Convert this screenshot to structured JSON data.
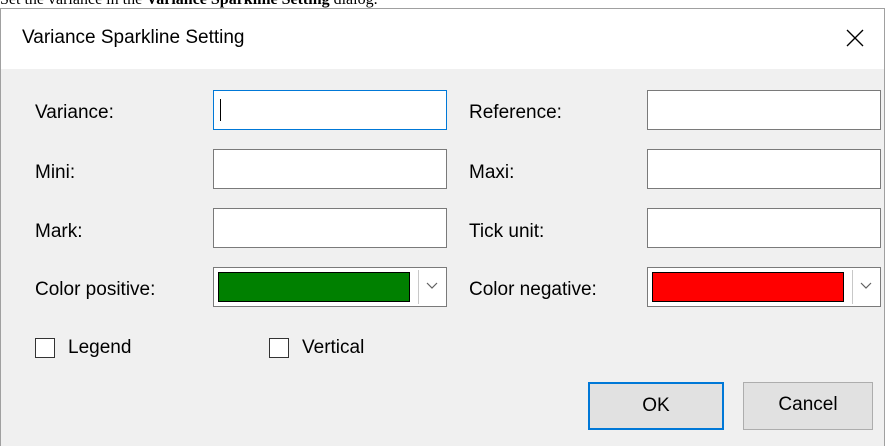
{
  "instruction": {
    "prefix": "Set the variance in the ",
    "bold": "Variance Sparkline Setting",
    "suffix": " dialog."
  },
  "dialog": {
    "title": "Variance Sparkline Setting",
    "close_icon": "close-icon"
  },
  "fields": {
    "variance": {
      "label": "Variance:",
      "value": ""
    },
    "reference": {
      "label": "Reference:",
      "value": ""
    },
    "mini": {
      "label": "Mini:",
      "value": ""
    },
    "maxi": {
      "label": "Maxi:",
      "value": ""
    },
    "mark": {
      "label": "Mark:",
      "value": ""
    },
    "tick_unit": {
      "label": "Tick unit:",
      "value": ""
    }
  },
  "colors": {
    "positive": {
      "label": "Color positive:",
      "value": "#008000"
    },
    "negative": {
      "label": "Color negative:",
      "value": "#ff0000"
    }
  },
  "checkboxes": {
    "legend": {
      "label": "Legend",
      "checked": false
    },
    "vertical": {
      "label": "Vertical",
      "checked": false
    }
  },
  "buttons": {
    "ok": "OK",
    "cancel": "Cancel"
  },
  "accent_color": "#0078d7"
}
